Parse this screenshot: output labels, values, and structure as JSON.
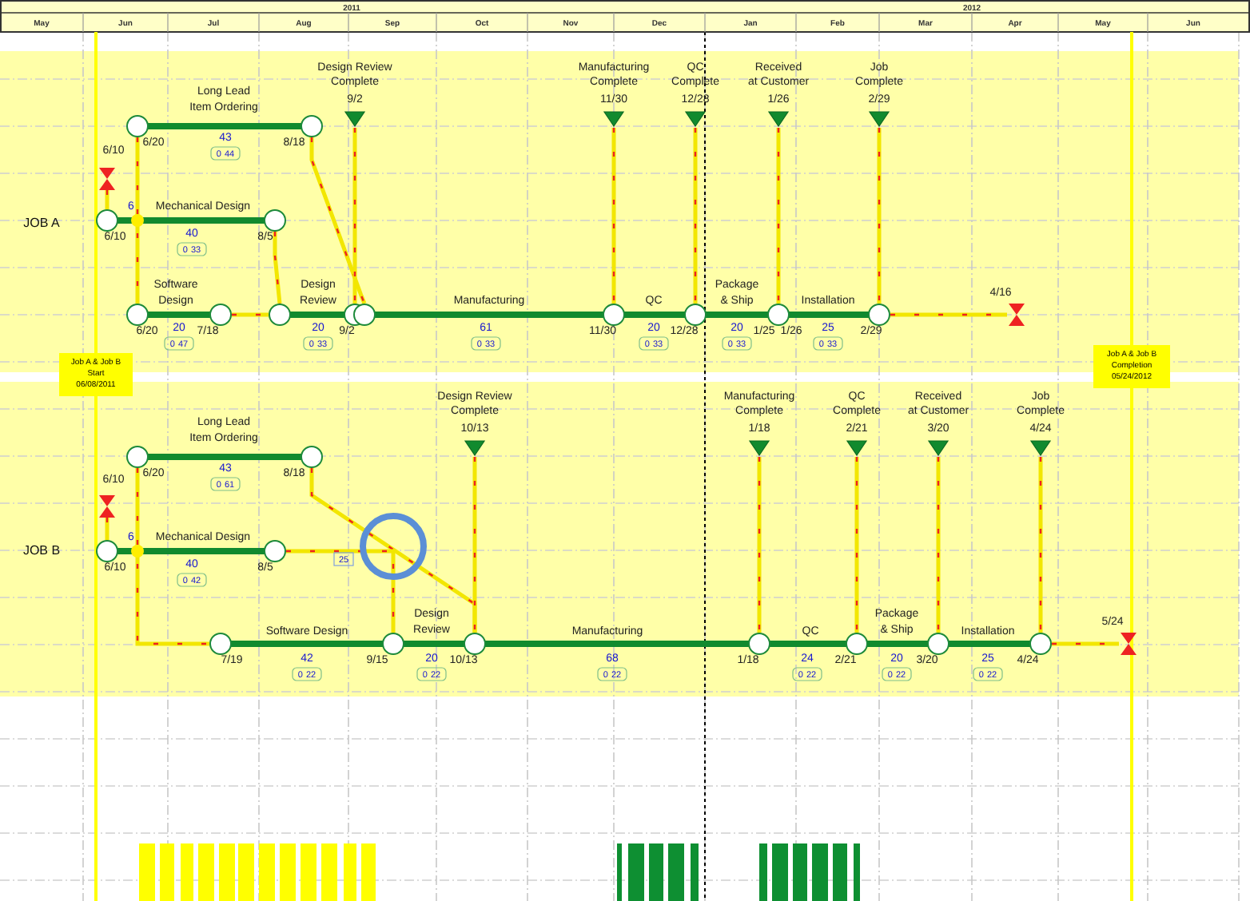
{
  "timeline": {
    "years": [
      "2011",
      "2012"
    ],
    "months": [
      "May",
      "Jun",
      "Jul",
      "Aug",
      "Sep",
      "Oct",
      "Nov",
      "Dec",
      "Jan",
      "Feb",
      "Mar",
      "Apr",
      "May",
      "Jun"
    ]
  },
  "start_flag": {
    "lines": [
      "Job A & Job B",
      "Start",
      "06/08/2011"
    ]
  },
  "finish_flag": {
    "lines": [
      "Job A & Job B",
      "Completion",
      "05/24/2012"
    ]
  },
  "jobs": [
    {
      "label": "JOB A",
      "start_date": "6/10",
      "end_date": "4/16",
      "note": "6",
      "activities": [
        {
          "name": [
            "Long Lead",
            "Item Ordering"
          ],
          "duration": "43",
          "float": [
            "0",
            "44"
          ]
        },
        {
          "name": [
            "Mechanical Design"
          ],
          "duration": "40",
          "float": [
            "0",
            "33"
          ]
        },
        {
          "name": [
            "Software",
            "Design"
          ],
          "duration": "20",
          "float": [
            "0",
            "47"
          ]
        },
        {
          "name": [
            "Design",
            "Review"
          ],
          "duration": "20",
          "float": [
            "0",
            "33"
          ]
        },
        {
          "name": [
            "Manufacturing"
          ],
          "duration": "61",
          "float": [
            "0",
            "33"
          ]
        },
        {
          "name": [
            "QC"
          ],
          "duration": "20",
          "float": [
            "0",
            "33"
          ]
        },
        {
          "name": [
            "Package",
            "& Ship"
          ],
          "duration": "20",
          "float": [
            "0",
            "33"
          ]
        },
        {
          "name": [
            "Installation"
          ],
          "duration": "25",
          "float": [
            "0",
            "33"
          ]
        }
      ],
      "node_dates": [
        "6/20",
        "8/18",
        "6/10",
        "8/5",
        "6/20",
        "7/18",
        "9/2",
        "11/30",
        "12/28",
        "1/25",
        "1/26",
        "2/29"
      ],
      "milestones": [
        {
          "title": [
            "Design Review",
            "Complete"
          ],
          "date": "9/2"
        },
        {
          "title": [
            "Manufacturing",
            "Complete"
          ],
          "date": "11/30"
        },
        {
          "title": [
            "QC",
            "Complete"
          ],
          "date": "12/28"
        },
        {
          "title": [
            "Received",
            "at Customer"
          ],
          "date": "1/26"
        },
        {
          "title": [
            "Job",
            "Complete"
          ],
          "date": "2/29"
        }
      ]
    },
    {
      "label": "JOB B",
      "start_date": "6/10",
      "end_date": "5/24",
      "note": "6",
      "lag": "25",
      "activities": [
        {
          "name": [
            "Long Lead",
            "Item Ordering"
          ],
          "duration": "43",
          "float": [
            "0",
            "61"
          ]
        },
        {
          "name": [
            "Mechanical Design"
          ],
          "duration": "40",
          "float": [
            "0",
            "42"
          ]
        },
        {
          "name": [
            "Software Design"
          ],
          "duration": "42",
          "float": [
            "0",
            "22"
          ]
        },
        {
          "name": [
            "Design",
            "Review"
          ],
          "duration": "20",
          "float": [
            "0",
            "22"
          ]
        },
        {
          "name": [
            "Manufacturing"
          ],
          "duration": "68",
          "float": [
            "0",
            "22"
          ]
        },
        {
          "name": [
            "QC"
          ],
          "duration": "24",
          "float": [
            "0",
            "22"
          ]
        },
        {
          "name": [
            "Package",
            "& Ship"
          ],
          "duration": "20",
          "float": [
            "0",
            "22"
          ]
        },
        {
          "name": [
            "Installation"
          ],
          "duration": "25",
          "float": [
            "0",
            "22"
          ]
        }
      ],
      "node_dates": [
        "6/20",
        "8/18",
        "6/10",
        "8/5",
        "7/19",
        "9/15",
        "10/13",
        "1/18",
        "2/21",
        "3/20",
        "4/24"
      ],
      "milestones": [
        {
          "title": [
            "Design Review",
            "Complete"
          ],
          "date": "10/13"
        },
        {
          "title": [
            "Manufacturing",
            "Complete"
          ],
          "date": "1/18"
        },
        {
          "title": [
            "QC",
            "Complete"
          ],
          "date": "2/21"
        },
        {
          "title": [
            "Received",
            "at Customer"
          ],
          "date": "3/20"
        },
        {
          "title": [
            "Job",
            "Complete"
          ],
          "date": "4/24"
        }
      ]
    }
  ]
}
